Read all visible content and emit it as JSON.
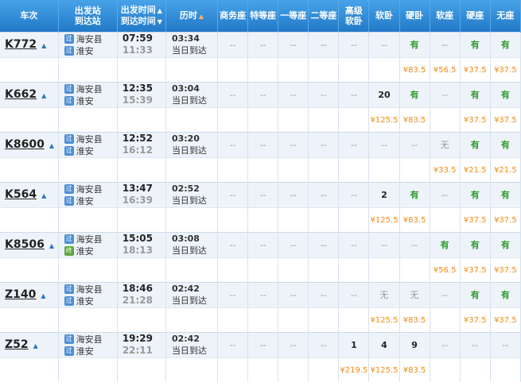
{
  "headers": {
    "train": "车次",
    "station_dep": "出发站",
    "station_arr": "到达站",
    "time_dep": "出发时间",
    "time_arr": "到达时间",
    "duration": "历时",
    "business": "商务座",
    "special": "特等座",
    "first": "一等座",
    "second": "二等座",
    "high_soft_1": "高级",
    "high_soft_2": "软卧",
    "soft_sleeper": "软卧",
    "hard_sleeper": "硬卧",
    "soft_seat": "软座",
    "hard_seat": "硬座",
    "no_seat": "无座"
  },
  "trains": [
    {
      "no": "K772",
      "from": "海安县",
      "to": "淮安",
      "from_badge": "过",
      "to_badge": "过",
      "dep": "07:59",
      "arr": "11:33",
      "dur": "03:34",
      "note": "当日到达",
      "seats": [
        "--",
        "--",
        "--",
        "--",
        "--",
        "--",
        "有",
        "--",
        "有",
        "有"
      ],
      "prices": [
        "",
        "",
        "",
        "",
        "",
        "",
        "¥83.5",
        "¥56.5",
        "¥37.5",
        "¥37.5"
      ]
    },
    {
      "no": "K662",
      "from": "海安县",
      "to": "淮安",
      "from_badge": "过",
      "to_badge": "过",
      "dep": "12:35",
      "arr": "15:39",
      "dur": "03:04",
      "note": "当日到达",
      "seats": [
        "--",
        "--",
        "--",
        "--",
        "--",
        "20",
        "有",
        "--",
        "有",
        "有"
      ],
      "prices": [
        "",
        "",
        "",
        "",
        "",
        "¥125.5",
        "¥83.5",
        "",
        "¥37.5",
        "¥37.5"
      ]
    },
    {
      "no": "K8600",
      "from": "海安县",
      "to": "淮安",
      "from_badge": "过",
      "to_badge": "过",
      "dep": "12:52",
      "arr": "16:12",
      "dur": "03:20",
      "note": "当日到达",
      "seats": [
        "--",
        "--",
        "--",
        "--",
        "--",
        "--",
        "--",
        "无",
        "有",
        "有"
      ],
      "prices": [
        "",
        "",
        "",
        "",
        "",
        "",
        "",
        "¥33.5",
        "¥21.5",
        "¥21.5"
      ]
    },
    {
      "no": "K564",
      "from": "海安县",
      "to": "淮安",
      "from_badge": "过",
      "to_badge": "过",
      "dep": "13:47",
      "arr": "16:39",
      "dur": "02:52",
      "note": "当日到达",
      "seats": [
        "--",
        "--",
        "--",
        "--",
        "--",
        "2",
        "有",
        "--",
        "有",
        "有"
      ],
      "prices": [
        "",
        "",
        "",
        "",
        "",
        "¥125.5",
        "¥83.5",
        "",
        "¥37.5",
        "¥37.5"
      ]
    },
    {
      "no": "K8506",
      "from": "海安县",
      "to": "淮安",
      "from_badge": "过",
      "to_badge": "终",
      "dep": "15:05",
      "arr": "18:13",
      "dur": "03:08",
      "note": "当日到达",
      "seats": [
        "--",
        "--",
        "--",
        "--",
        "--",
        "--",
        "--",
        "有",
        "有",
        "有"
      ],
      "prices": [
        "",
        "",
        "",
        "",
        "",
        "",
        "",
        "¥56.5",
        "¥37.5",
        "¥37.5"
      ]
    },
    {
      "no": "Z140",
      "from": "海安县",
      "to": "淮安",
      "from_badge": "过",
      "to_badge": "过",
      "dep": "18:46",
      "arr": "21:28",
      "dur": "02:42",
      "note": "当日到达",
      "seats": [
        "--",
        "--",
        "--",
        "--",
        "--",
        "无",
        "无",
        "--",
        "有",
        "有"
      ],
      "prices": [
        "",
        "",
        "",
        "",
        "",
        "¥125.5",
        "¥83.5",
        "",
        "¥37.5",
        "¥37.5"
      ]
    },
    {
      "no": "Z52",
      "from": "海安县",
      "to": "淮安",
      "from_badge": "过",
      "to_badge": "过",
      "dep": "19:29",
      "arr": "22:11",
      "dur": "02:42",
      "note": "当日到达",
      "seats": [
        "--",
        "--",
        "--",
        "--",
        "1",
        "4",
        "9",
        "--",
        "--",
        "--"
      ],
      "prices": [
        "",
        "",
        "",
        "",
        "¥219.5",
        "¥125.5",
        "¥83.5",
        "",
        "",
        ""
      ]
    }
  ],
  "colors": {
    "header": "#2f8fd6",
    "available": "#2a9c2a",
    "price": "#f08a14",
    "row_bg": "#eef3f9"
  },
  "icons": {
    "sort_up": "triangle-up",
    "sort_down": "triangle-up-orange",
    "train_expand": "triangle-up-small"
  }
}
